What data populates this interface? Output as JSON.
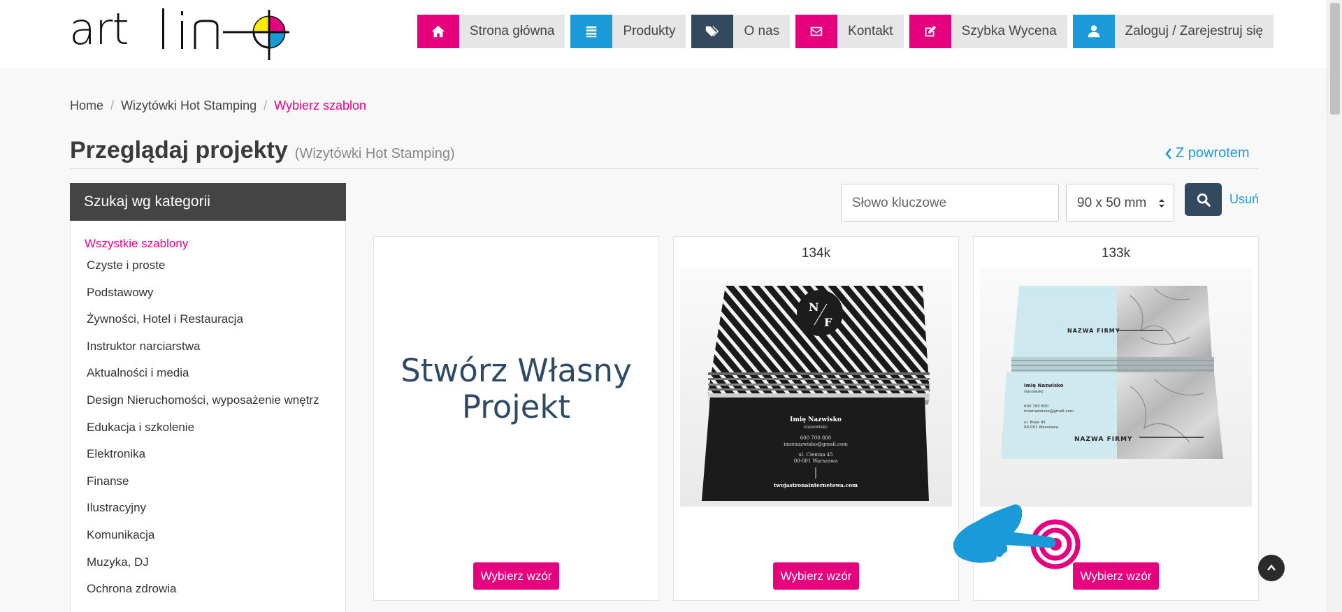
{
  "nav": [
    {
      "label": "Strona główna",
      "icon": "home-icon",
      "color": "#e6007e"
    },
    {
      "label": "Produkty",
      "icon": "list-icon",
      "color": "#1a9ad9"
    },
    {
      "label": "O nas",
      "icon": "tags-icon",
      "color": "#334a5e"
    },
    {
      "label": "Kontakt",
      "icon": "envelope-icon",
      "color": "#e6007e"
    },
    {
      "label": "Szybka Wycena",
      "icon": "edit-icon",
      "color": "#e6007e"
    },
    {
      "label": "Zaloguj / Zarejestruj się",
      "icon": "user-icon",
      "color": "#1a9ad9"
    }
  ],
  "breadcrumb": [
    "Home",
    "Wizytówki Hot Stamping",
    "Wybierz szablon"
  ],
  "page": {
    "title": "Przeglądaj projekty",
    "subtitle": "(Wizytówki Hot Stamping)",
    "back": "Z powrotem"
  },
  "sidebar": {
    "title": "Szukaj wg kategorii",
    "categories": [
      "Wszystkie szablony",
      "Czyste i proste",
      "Podstawowy",
      "Żywności, Hotel i Restauracja",
      "Instruktor narciarstwa",
      "Aktualności i media",
      "Design Nieruchomości, wyposażenie wnętrz",
      "Edukacja i szkolenie",
      "Elektronika",
      "Finanse",
      "Ilustracyjny",
      "Komunikacja",
      "Muzyka, DJ",
      "Ochrona zdrowia"
    ]
  },
  "search": {
    "placeholder": "Słowo kluczowe",
    "size": "90 x 50 mm",
    "clear": "Usuń"
  },
  "cards": [
    {
      "views": "",
      "text": "Stwórz Własny Projekt",
      "button": "Wybierz wzór"
    },
    {
      "views": "134k",
      "button": "Wybierz wzór",
      "card_text": {
        "monogram_top": "N",
        "monogram_bottom": "F",
        "name": "Imię Nazwisko",
        "role": "stanowisko",
        "phone": "600 700 800",
        "email": "imienazwisko@gmail.com",
        "address1": "ul. Ciemna 45",
        "address2": "00-001 Warszawa",
        "web": "twojastronainternetowa.com"
      }
    },
    {
      "views": "133k",
      "button": "Wybierz wzór",
      "card_text": {
        "company": "NAZWA FIRMY",
        "name": "Imię Nazwisko",
        "role": "stanowisko",
        "phone": "600 700 800",
        "email": "imienazwisko@gmail.com",
        "address1": "ul. Biała 45",
        "address2": "00-001 Warszawa"
      }
    }
  ],
  "colors": {
    "accent": "#e6007e",
    "blue": "#1a9ad9",
    "navy": "#334a5e"
  }
}
